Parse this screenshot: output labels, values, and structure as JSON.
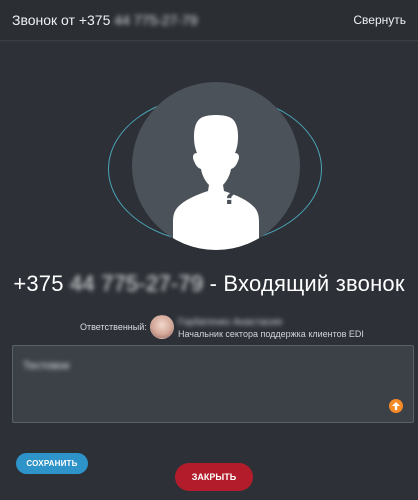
{
  "window": {
    "title_prefix": "Звонок от",
    "title_number_visible": "+375",
    "title_number_blurred": "44 775-27-79",
    "collapse_label": "Свернуть"
  },
  "call": {
    "number_visible": "+375",
    "number_blurred": "44 775-27-79",
    "status_text": "- Входящий звонок"
  },
  "responsible": {
    "label": "Ответственный:",
    "name_blurred": "Горбатенко Анастасия",
    "role": "Начальник сектора поддержка клиентов EDI"
  },
  "comment": {
    "value_blurred": "Тестовое"
  },
  "buttons": {
    "save": "СОХРАНИТЬ",
    "close": "ЗАКРЫТЬ"
  },
  "icons": {
    "avatar_placeholder": "unknown-person-icon",
    "send": "arrow-up-icon"
  },
  "colors": {
    "background": "#2f3338",
    "accent_blue": "#2e93c9",
    "danger_red": "#b31d2b",
    "ring": "#4aa3b6",
    "orange": "#f28b28"
  }
}
